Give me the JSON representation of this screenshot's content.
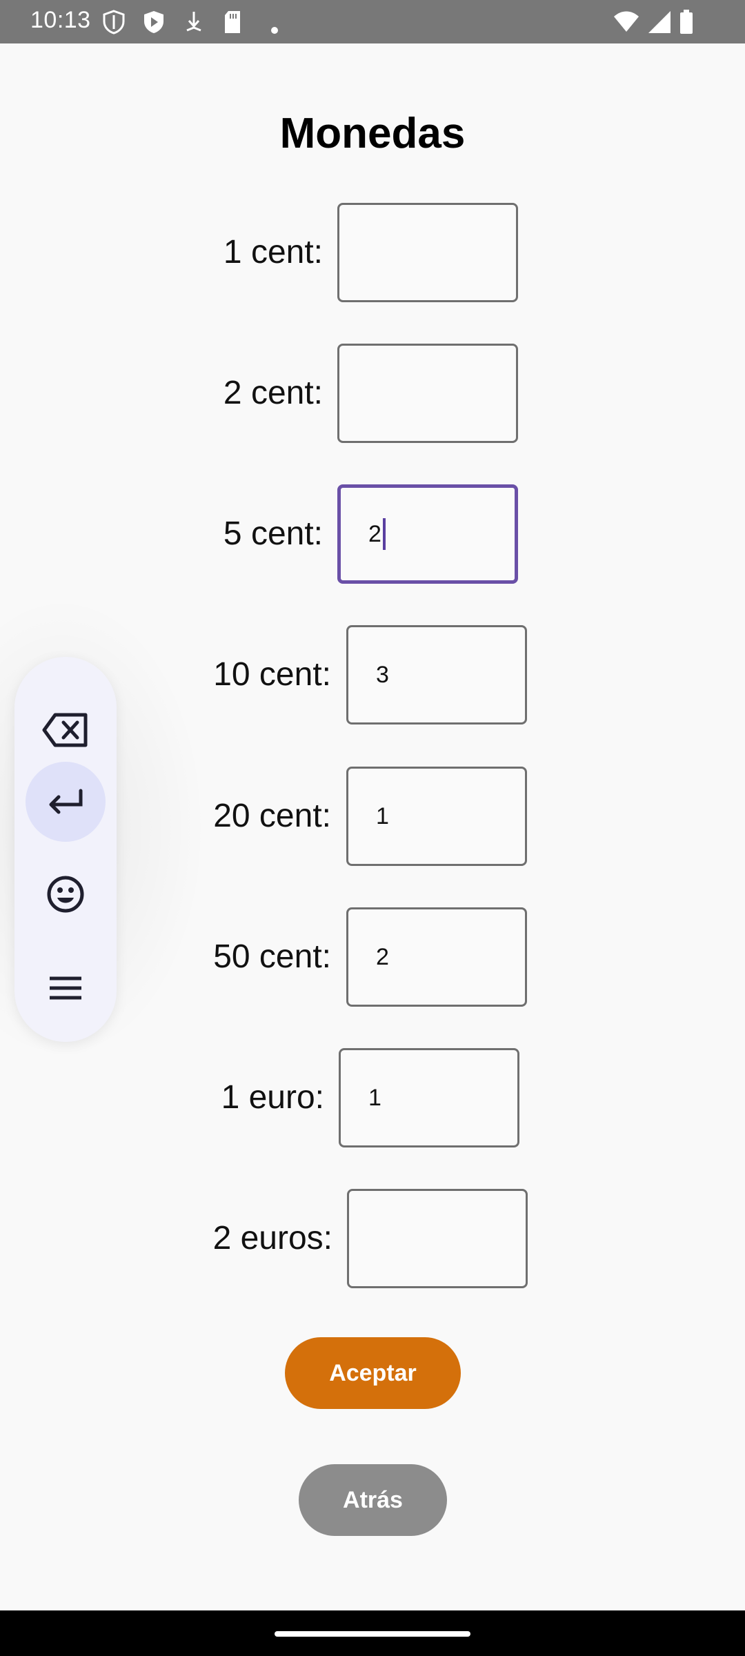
{
  "status_bar": {
    "time": "10:13"
  },
  "title": "Monedas",
  "rows": [
    {
      "label": "1 cent:",
      "value": ""
    },
    {
      "label": "2 cent:",
      "value": ""
    },
    {
      "label": "5 cent:",
      "value": "2"
    },
    {
      "label": "10 cent:",
      "value": "3"
    },
    {
      "label": "20 cent:",
      "value": "1"
    },
    {
      "label": "50 cent:",
      "value": "2"
    },
    {
      "label": "1 euro:",
      "value": "1"
    },
    {
      "label": "2 euros:",
      "value": ""
    }
  ],
  "buttons": {
    "accept": "Aceptar",
    "back": "Atrás"
  },
  "floating_toolbar": {
    "items": [
      "backspace-icon",
      "enter-icon",
      "emoji-icon",
      "menu-icon"
    ],
    "active_item": "enter-icon"
  },
  "colors": {
    "accent": "#d4700b",
    "focus": "#6a50a7",
    "secondary_button": "#8c8c8c"
  }
}
